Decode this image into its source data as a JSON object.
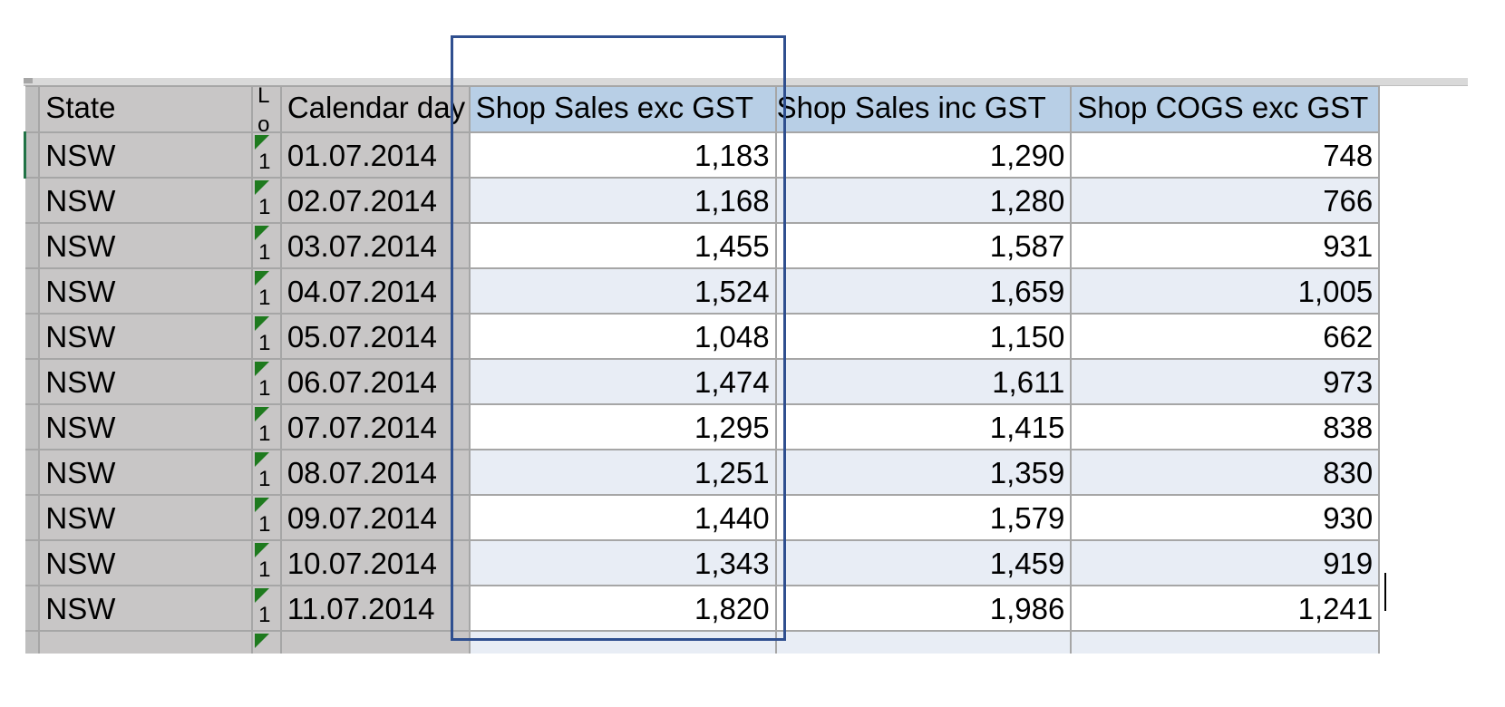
{
  "headers": {
    "state": "State",
    "small_col_top": "L",
    "small_col_bottom": "o",
    "calendar_day": "Calendar day",
    "shop_sales_exc_gst": "Shop Sales exc GST",
    "shop_sales_inc_gst": "Shop Sales inc GST",
    "shop_cogs_exc_gst": "Shop COGS exc GST"
  },
  "flag_digit": "1",
  "rows": [
    {
      "state": "NSW",
      "day": "01.07.2014",
      "sales_exc": "1,183",
      "sales_inc": "1,290",
      "cogs": "748"
    },
    {
      "state": "NSW",
      "day": "02.07.2014",
      "sales_exc": "1,168",
      "sales_inc": "1,280",
      "cogs": "766"
    },
    {
      "state": "NSW",
      "day": "03.07.2014",
      "sales_exc": "1,455",
      "sales_inc": "1,587",
      "cogs": "931"
    },
    {
      "state": "NSW",
      "day": "04.07.2014",
      "sales_exc": "1,524",
      "sales_inc": "1,659",
      "cogs": "1,005"
    },
    {
      "state": "NSW",
      "day": "05.07.2014",
      "sales_exc": "1,048",
      "sales_inc": "1,150",
      "cogs": "662"
    },
    {
      "state": "NSW",
      "day": "06.07.2014",
      "sales_exc": "1,474",
      "sales_inc": "1,611",
      "cogs": "973"
    },
    {
      "state": "NSW",
      "day": "07.07.2014",
      "sales_exc": "1,295",
      "sales_inc": "1,415",
      "cogs": "838"
    },
    {
      "state": "NSW",
      "day": "08.07.2014",
      "sales_exc": "1,251",
      "sales_inc": "1,359",
      "cogs": "830"
    },
    {
      "state": "NSW",
      "day": "09.07.2014",
      "sales_exc": "1,440",
      "sales_inc": "1,579",
      "cogs": "930"
    },
    {
      "state": "NSW",
      "day": "10.07.2014",
      "sales_exc": "1,343",
      "sales_inc": "1,459",
      "cogs": "919"
    },
    {
      "state": "NSW",
      "day": "11.07.2014",
      "sales_exc": "1,820",
      "sales_inc": "1,986",
      "cogs": "1,241"
    }
  ],
  "colors": {
    "header_blue": "#b8cfe6",
    "gray_column": "#c8c6c6",
    "banded_row": "#e8edf5",
    "highlight_box": "#2f4f8f",
    "flag_green": "#1e7a1e"
  }
}
